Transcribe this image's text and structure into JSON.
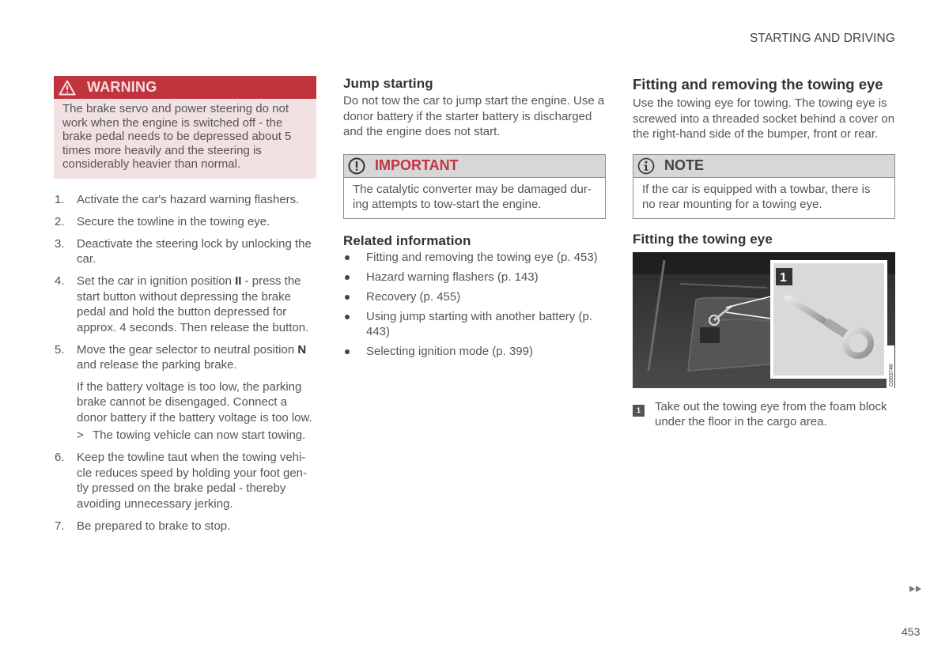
{
  "running_head": "STARTING AND DRIVING",
  "page_number": "453",
  "next_page_icon": "double-triangle-right",
  "warning": {
    "icon": "warning-triangle-icon",
    "title": "WARNING",
    "text": "The brake servo and power steering do not work when the engine is switched off - the brake pedal needs to be depressed about 5 times more heavily and the steering is considerably heavier than normal.",
    "colors": {
      "header": "#c0353d",
      "background": "#f1e1e2"
    }
  },
  "steps": [
    {
      "num": "1.",
      "text": "Activate the car's hazard warning flashers."
    },
    {
      "num": "2.",
      "text": "Secure the towline in the towing eye."
    },
    {
      "num": "3.",
      "text": "Deactivate the steering lock by unlocking the car."
    },
    {
      "num": "4.",
      "text_before": "Set the car in ignition position ",
      "bold": "II",
      "text_after": " - press the start button without depressing the brake pedal and hold the button depressed for approx. 4 seconds. Then release the button."
    },
    {
      "num": "5.",
      "text_before": "Move the gear selector to neutral position ",
      "bold": "N",
      "text_after": " and release the parking brake.",
      "sub_paragraph": "If the battery voltage is too low, the parking brake cannot be disengaged. Connect a donor battery if the battery voltage is too low.",
      "result_marker": ">",
      "result": "The towing vehicle can now start towing."
    },
    {
      "num": "6.",
      "text": "Keep the towline taut when the towing vehi-cle reduces speed by holding your foot gen-tly pressed on the brake pedal - thereby avoiding unnecessary jerking."
    },
    {
      "num": "7.",
      "text": "Be prepared to brake to stop."
    }
  ],
  "jump_starting": {
    "heading": "Jump starting",
    "text": "Do not tow the car to jump start the engine. Use a donor battery if the starter battery is discharged and the engine does not start."
  },
  "important": {
    "icon": "exclamation-circle-icon",
    "title": "IMPORTANT",
    "text": "The catalytic converter may be damaged dur-ing attempts to tow-start the engine."
  },
  "related": {
    "heading": "Related information",
    "items": [
      "Fitting and removing the towing eye (p. 453)",
      "Hazard warning flashers (p. 143)",
      "Recovery (p. 455)",
      "Using jump starting with another battery (p. 443)",
      "Selecting ignition mode (p. 399)"
    ]
  },
  "fitting": {
    "heading": "Fitting and removing the towing eye",
    "text": "Use the towing eye for towing. The towing eye is screwed into a threaded socket behind a cover on the right-hand side of the bumper, front or rear."
  },
  "note": {
    "icon": "info-circle-icon",
    "title": "NOTE",
    "text": "If the car is equipped with a towbar, there is no rear mounting for a towing eye."
  },
  "fitting_eye": {
    "heading": "Fitting the towing eye",
    "figure": {
      "callout": "1",
      "image_code": "G063746",
      "description": "Cargo area floor with towing eye in foam block"
    },
    "caption_badge": "1",
    "caption": "Take out the towing eye from the foam block under the floor in the cargo area."
  }
}
